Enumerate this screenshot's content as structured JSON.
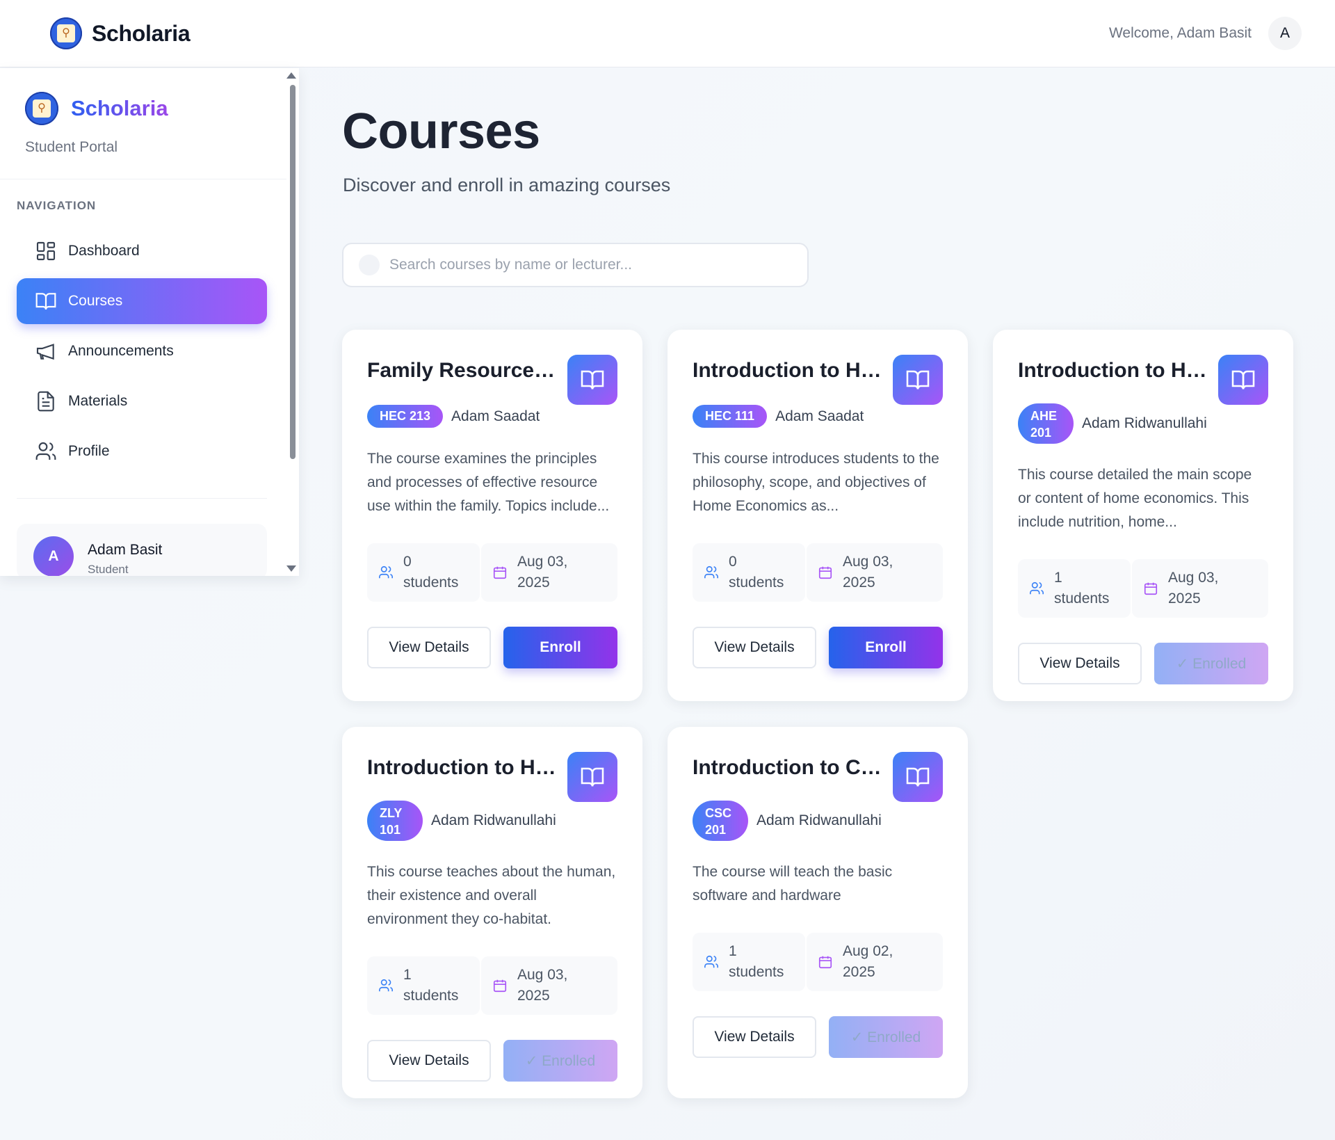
{
  "app": {
    "brand": "Scholaria",
    "welcome": "Welcome, Adam Basit",
    "avatar_letter": "A",
    "accent_start": "#3b82f6",
    "accent_end": "#a855f7"
  },
  "sidebar": {
    "brand": "Scholaria",
    "subtitle": "Student Portal",
    "nav_heading": "NAVIGATION",
    "items": [
      {
        "label": "Dashboard",
        "icon": "dashboard-grid-icon",
        "active": false
      },
      {
        "label": "Courses",
        "icon": "book-open-icon",
        "active": true
      },
      {
        "label": "Announcements",
        "icon": "megaphone-icon",
        "active": false
      },
      {
        "label": "Materials",
        "icon": "document-icon",
        "active": false
      },
      {
        "label": "Profile",
        "icon": "users-icon",
        "active": false
      }
    ],
    "user": {
      "initial": "A",
      "name": "Adam Basit",
      "role": "Student"
    }
  },
  "main": {
    "title": "Courses",
    "subtitle": "Discover and enroll in amazing courses",
    "search_placeholder": "Search courses by name or lecturer..."
  },
  "courses": [
    {
      "title": "Family Resource Management",
      "code": "HEC 213",
      "lecturer": "Adam Saadat",
      "description": "The course examines the principles and processes of effective resource use within the family. Topics include...",
      "students": "0",
      "students_label": "students",
      "date_line1": "Aug 03,",
      "date_line2": "2025",
      "view_label": "View Details",
      "action_label": "Enroll",
      "enrolled": false
    },
    {
      "title": "Introduction to Home Economics",
      "code": "HEC 111",
      "lecturer": "Adam Saadat",
      "description": "This course introduces students to the philosophy, scope, and objectives of Home Economics as...",
      "students": "0",
      "students_label": "students",
      "date_line1": "Aug 03,",
      "date_line2": "2025",
      "view_label": "View Details",
      "action_label": "Enroll",
      "enrolled": false
    },
    {
      "title": "Introduction to Home Economics",
      "code": "AHE 201",
      "lecturer": "Adam Ridwanullahi",
      "description": "This course detailed the main scope or content of home economics. This include nutrition, home...",
      "students": "1",
      "students_label": "students",
      "date_line1": "Aug 03,",
      "date_line2": "2025",
      "view_label": "View Details",
      "action_label": "✓ Enrolled",
      "enrolled": true
    },
    {
      "title": "Introduction to Human Biology",
      "code": "ZLY 101",
      "lecturer": "Adam Ridwanullahi",
      "description": "This course teaches about the human, their existence and overall environment they co-habitat.",
      "students": "1",
      "students_label": "students",
      "date_line1": "Aug 03,",
      "date_line2": "2025",
      "view_label": "View Details",
      "action_label": "✓ Enrolled",
      "enrolled": true
    },
    {
      "title": "Introduction to Computer Science",
      "code": "CSC 201",
      "lecturer": "Adam Ridwanullahi",
      "description": "The course will teach the basic software and hardware",
      "students": "1",
      "students_label": "students",
      "date_line1": "Aug 02,",
      "date_line2": "2025",
      "view_label": "View Details",
      "action_label": "✓ Enrolled",
      "enrolled": true
    }
  ]
}
